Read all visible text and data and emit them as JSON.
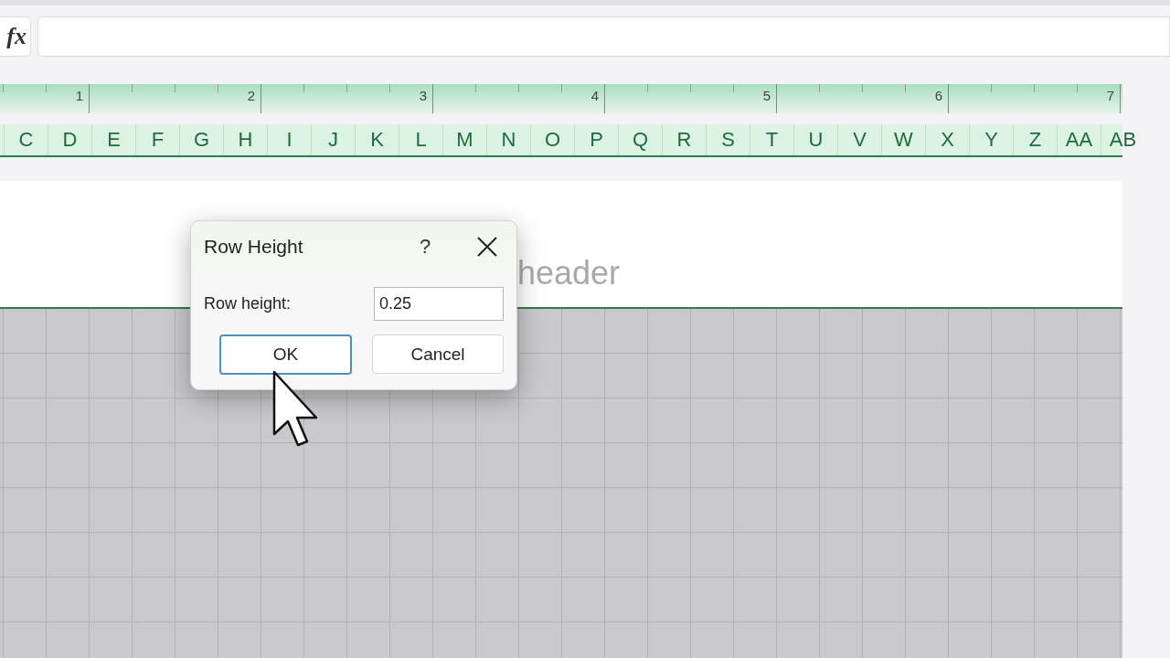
{
  "formula_bar": {
    "function_label": "fx"
  },
  "ruler": {
    "marks": [
      "1",
      "2",
      "3",
      "4",
      "5",
      "6",
      "7"
    ]
  },
  "column_headers": [
    "C",
    "D",
    "E",
    "F",
    "G",
    "H",
    "I",
    "J",
    "K",
    "L",
    "M",
    "N",
    "O",
    "P",
    "Q",
    "R",
    "S",
    "T",
    "U",
    "V",
    "W",
    "X",
    "Y",
    "Z",
    "AA",
    "AB"
  ],
  "page_header": {
    "text": "header"
  },
  "dialog": {
    "title": "Row Height",
    "help": "?",
    "field": {
      "label": "Row height:",
      "value": "0.25"
    },
    "buttons": [
      {
        "label": "OK",
        "focused": true
      },
      {
        "label": "Cancel",
        "focused": false
      }
    ]
  }
}
